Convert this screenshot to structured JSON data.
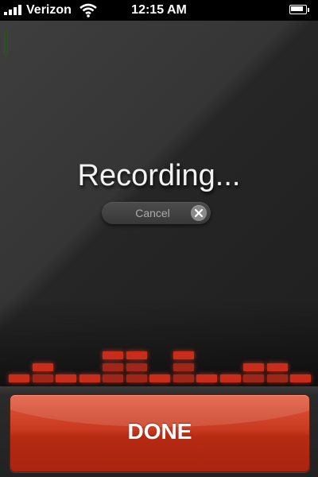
{
  "status_bar": {
    "carrier": "Verizon",
    "time": "12:15 AM",
    "signal_bars": 4,
    "battery_level": 0.8
  },
  "main": {
    "title": "Recording...",
    "cancel_label": "Cancel"
  },
  "level_meter": {
    "color": "#e8321c",
    "column_levels": [
      0.2,
      0.4,
      0.2,
      0.2,
      0.6,
      0.6,
      0.2,
      0.6,
      0.2,
      0.2,
      0.4,
      0.4,
      0.2
    ]
  },
  "footer": {
    "done_label": "DONE"
  },
  "colors": {
    "accent": "#c93a20",
    "background": "#2a2a2a"
  }
}
